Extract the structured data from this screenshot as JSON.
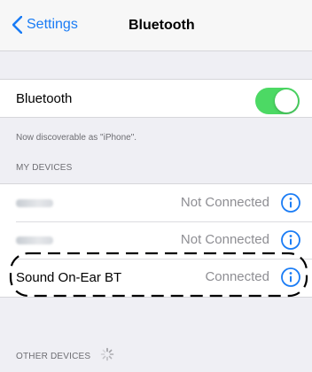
{
  "navbar": {
    "back_label": "Settings",
    "title": "Bluetooth"
  },
  "bluetooth": {
    "label": "Bluetooth",
    "enabled": true,
    "discoverable_text": "Now discoverable as \"iPhone\"."
  },
  "my_devices": {
    "header": "MY DEVICES",
    "items": [
      {
        "name": "",
        "status": "Not Connected"
      },
      {
        "name": "",
        "status": "Not Connected"
      },
      {
        "name": "Sound On-Ear BT",
        "status": "Connected"
      }
    ]
  },
  "other_devices": {
    "header": "OTHER DEVICES"
  },
  "colors": {
    "accent": "#1a7cf5",
    "toggle_on": "#4cd964",
    "background": "#efeff4"
  },
  "icons": [
    "chevron-left-icon",
    "info-icon",
    "spinner-icon"
  ]
}
